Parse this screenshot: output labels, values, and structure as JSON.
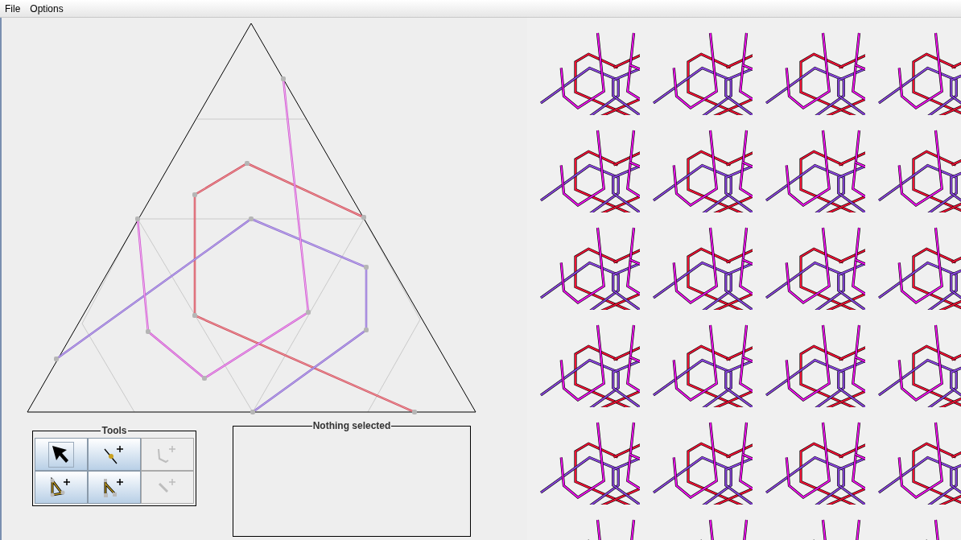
{
  "menu": [
    {
      "label": "File"
    },
    {
      "label": "Options"
    }
  ],
  "tools_panel": {
    "title": "Tools",
    "tools": [
      {
        "kind": "pointer",
        "selected": true,
        "disabled": false
      },
      {
        "kind": "point",
        "selected": false,
        "disabled": false
      },
      {
        "kind": "bend",
        "selected": false,
        "disabled": true
      },
      {
        "kind": "triangle",
        "selected": false,
        "disabled": false
      },
      {
        "kind": "corner",
        "selected": false,
        "disabled": false
      },
      {
        "kind": "segment",
        "selected": false,
        "disabled": true
      }
    ]
  },
  "selection_panel": {
    "title": "Nothing selected"
  }
}
